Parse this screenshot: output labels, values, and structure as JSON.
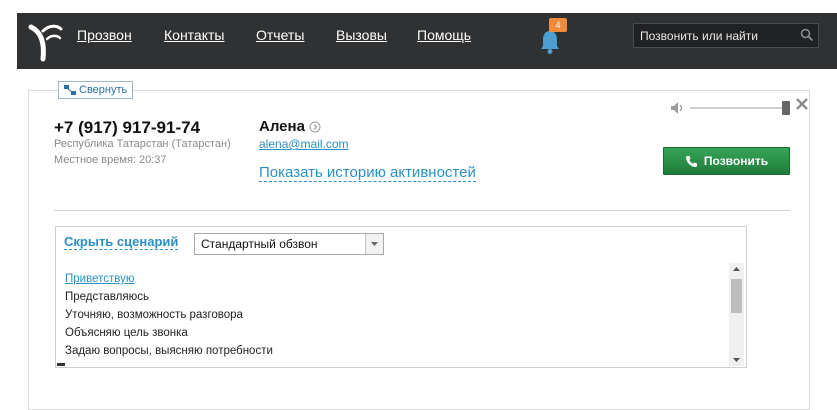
{
  "nav": {
    "items": [
      "Прозвон",
      "Контакты",
      "Отчеты",
      "Вызовы",
      "Помощь"
    ],
    "notifications_count": "4",
    "search_placeholder": "Позвонить или найти"
  },
  "panel": {
    "collapse_label": "Свернуть",
    "phone": "+7 (917) 917-91-74",
    "region": "Республика Татарстан (Татарстан)",
    "local_time": "Местное время: 20:37",
    "contact_name": "Алена",
    "email": "alena@mail.com",
    "history_link": "Показать историю активностей",
    "call_button": "Позвонить",
    "volume_level": 1.0
  },
  "script": {
    "hide_label": "Скрыть сценарий",
    "selected_scenario": "Стандартный обзвон",
    "steps": [
      "Приветствую",
      "Представляюсь",
      "Уточняю, возможность разговора",
      "Объясняю цель звонка",
      "Задаю вопросы, выясняю потребности"
    ],
    "active_step": "Приветствую"
  },
  "colors": {
    "topbar": "#2f3133",
    "link": "#2b8fc7",
    "call_green": "#2a9147",
    "badge": "#f08a3c"
  }
}
